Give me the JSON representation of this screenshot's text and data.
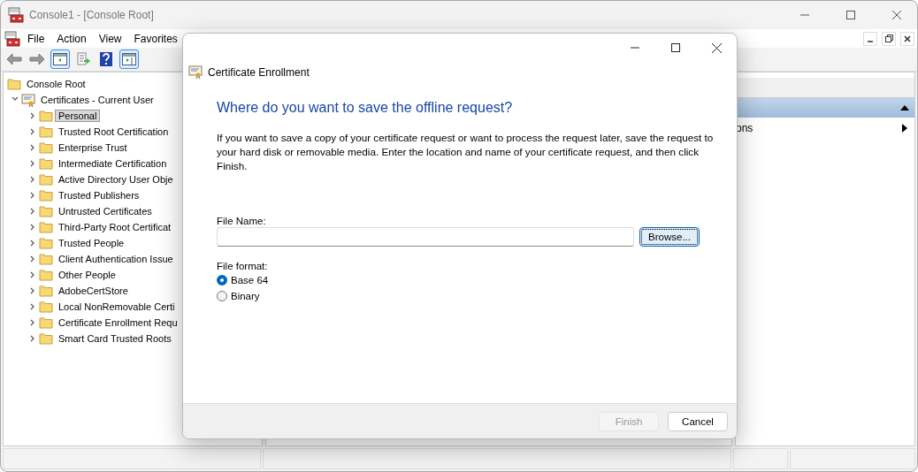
{
  "window": {
    "title": "Console1 - [Console Root]"
  },
  "menu": [
    "File",
    "Action",
    "View",
    "Favorites"
  ],
  "toolbar": [
    {
      "kind": "back",
      "selected": false
    },
    {
      "kind": "forward",
      "selected": false
    },
    {
      "kind": "tree",
      "selected": true
    },
    {
      "kind": "export",
      "selected": false
    },
    {
      "kind": "help",
      "selected": false
    },
    {
      "kind": "actions",
      "selected": true
    }
  ],
  "tree": {
    "label": "Console Root",
    "children": [
      {
        "label": "Certificates - Current User",
        "expanded": true,
        "children": [
          {
            "label": "Personal",
            "selected": true
          },
          {
            "label": "Trusted Root Certification",
            "selected": false
          },
          {
            "label": "Enterprise Trust",
            "selected": false
          },
          {
            "label": "Intermediate Certification",
            "selected": false
          },
          {
            "label": "Active Directory User Obje",
            "selected": false
          },
          {
            "label": "Trusted Publishers",
            "selected": false
          },
          {
            "label": "Untrusted Certificates",
            "selected": false
          },
          {
            "label": "Third-Party Root Certificat",
            "selected": false
          },
          {
            "label": "Trusted People",
            "selected": false
          },
          {
            "label": "Client Authentication Issue",
            "selected": false
          },
          {
            "label": "Other People",
            "selected": false
          },
          {
            "label": "AdobeCertStore",
            "selected": false
          },
          {
            "label": "Local NonRemovable Certi",
            "selected": false
          },
          {
            "label": "Certificate Enrollment Requ",
            "selected": false
          },
          {
            "label": "Smart Card Trusted Roots",
            "selected": false
          }
        ]
      }
    ]
  },
  "actions": {
    "items": [
      {
        "label": "ons"
      }
    ]
  },
  "dialog": {
    "title": "Certificate Enrollment",
    "heading": "Where do you want to save the offline request?",
    "description": "If you want to save a copy of your certificate request or want to process the request later, save the request to your hard disk or removable media. Enter the location and name of your certificate request, and then click Finish.",
    "file_name": {
      "label": "File Name:"
    },
    "browse": "Browse...",
    "format_label": "File format:",
    "formats": [
      {
        "label": "Base 64",
        "selected": true
      },
      {
        "label": "Binary",
        "selected": false
      }
    ],
    "buttons": [
      {
        "label": "Finish",
        "disabled": true
      },
      {
        "label": "Cancel",
        "disabled": false
      }
    ]
  }
}
